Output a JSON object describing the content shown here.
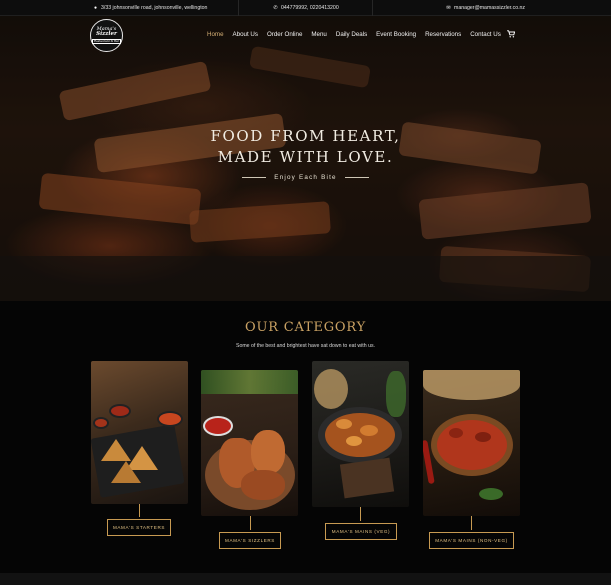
{
  "topbar": {
    "address": "3/33 johnsonville road, johnsonville, wellington",
    "phone": "044779992, 0220413200",
    "email": "manager@mamassizzler.co.nz"
  },
  "logo": {
    "line1": "Mama's",
    "line2": "Sizzler",
    "line3": "Restaurant & Bar"
  },
  "nav": [
    "Home",
    "About Us",
    "Order Online",
    "Menu",
    "Daily Deals",
    "Event Booking",
    "Reservations",
    "Contact Us"
  ],
  "hero": {
    "line1": "FOOD FROM HEART,",
    "line2": "MADE WITH LOVE.",
    "tagline": "Enjoy Each Bite"
  },
  "category": {
    "title": "OUR CATEGORY",
    "subtitle": "Some of the best and brightest have sat down to eat with us.",
    "items": [
      {
        "label": "MAMA'S STARTERS"
      },
      {
        "label": "MAMA'S SIZZLERS"
      },
      {
        "label": "MAMA'S MAINS (VEG)"
      },
      {
        "label": "MAMA'S MAINS (NON-VEG)"
      }
    ]
  },
  "colors": {
    "accent": "#c79a52",
    "active_nav": "#d8b276",
    "background": "#050505"
  }
}
